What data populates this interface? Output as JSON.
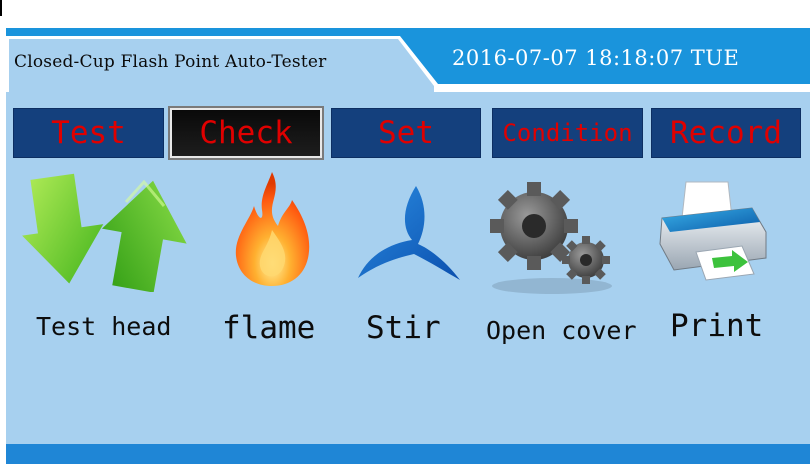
{
  "header": {
    "title": "Closed-Cup Flash Point Auto-Tester",
    "datetime": "2016-07-07 18:18:07 TUE"
  },
  "tabs": [
    {
      "label": "Test"
    },
    {
      "label": "Check",
      "active": true
    },
    {
      "label": "Set"
    },
    {
      "label": "Condition"
    },
    {
      "label": "Record"
    }
  ],
  "actions": [
    {
      "label": "Test head",
      "icon": "arrows-up-down-icon"
    },
    {
      "label": "flame",
      "icon": "flame-icon"
    },
    {
      "label": "Stir",
      "icon": "stir-blade-icon"
    },
    {
      "label": "Open cover",
      "icon": "gears-icon"
    },
    {
      "label": "Print",
      "icon": "printer-icon"
    }
  ],
  "colors": {
    "header_bg": "#1a94dc",
    "content_bg": "#a7d0ef",
    "tab_bg": "#14407d",
    "tab_text": "#e00000"
  }
}
